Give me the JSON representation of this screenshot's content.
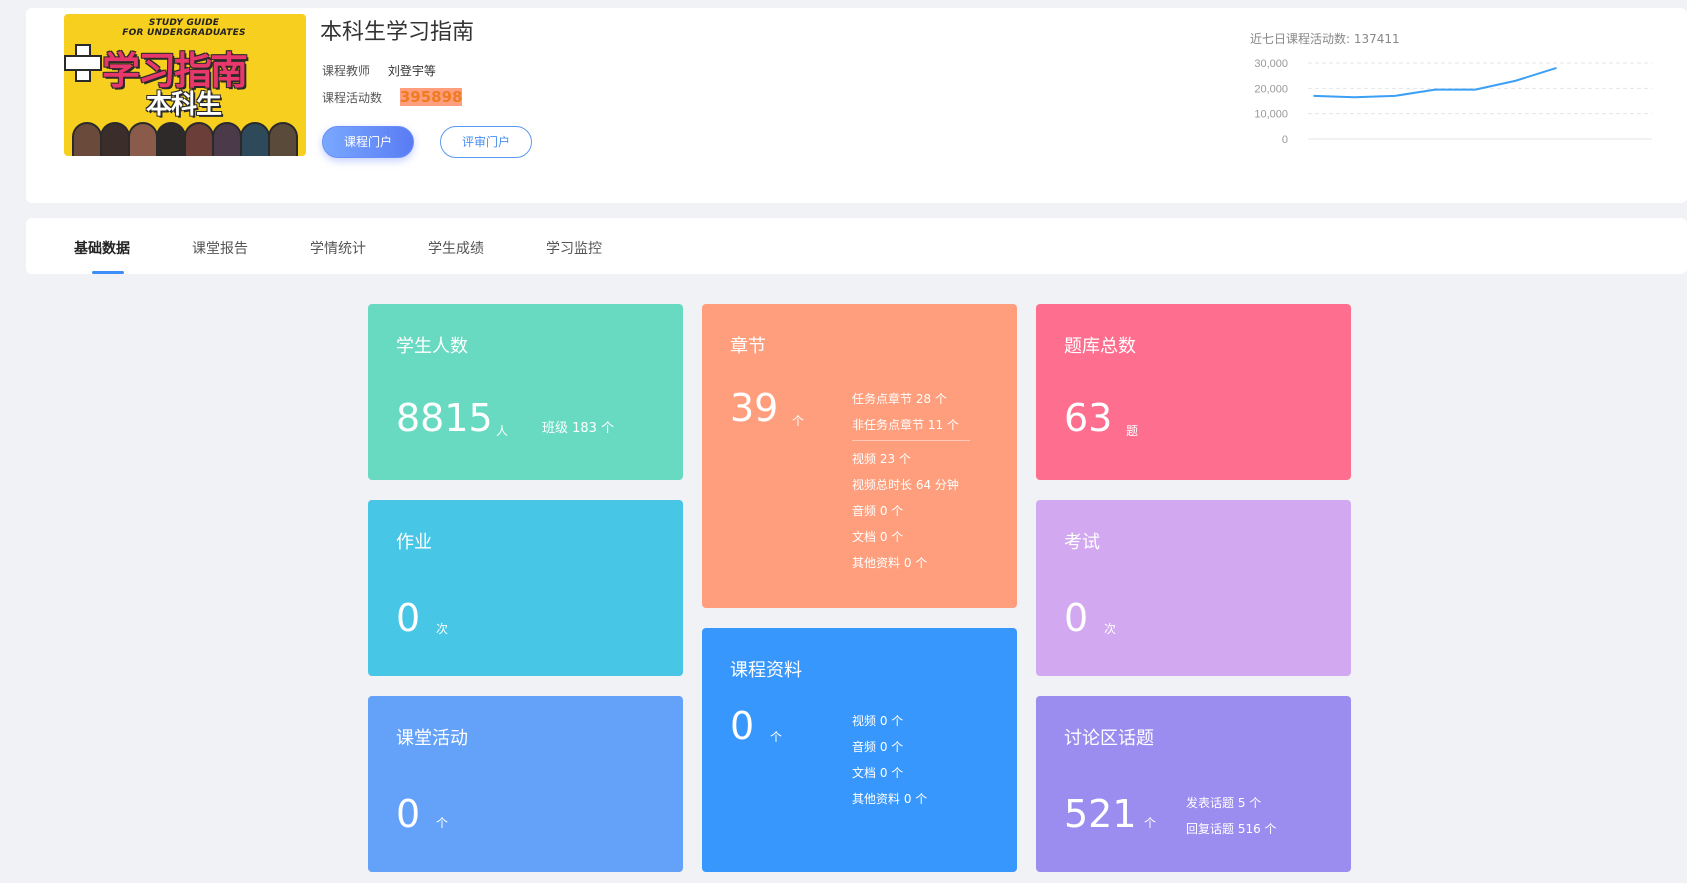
{
  "course": {
    "cover_en_line1": "STUDY GUIDE",
    "cover_en_line2": "FOR UNDERGRADUATES",
    "cover_title": "学习指南",
    "cover_subtitle": "本科生",
    "title": "本科生学习指南",
    "teacher_label": "课程教师",
    "teacher_value": "刘登宇等",
    "activity_label": "课程活动数",
    "activity_value": "395898",
    "btn_portal": "课程门户",
    "btn_review": "评审门户"
  },
  "trend": {
    "label": "近七日课程活动数: 137411",
    "y_ticks": [
      "30,000",
      "20,000",
      "10,000",
      "0"
    ]
  },
  "chart_data": {
    "type": "line",
    "title": "近七日课程活动数: 137411",
    "ylim": [
      0,
      30000
    ],
    "y_ticks": [
      "30,000",
      "20,000",
      "10,000",
      "0"
    ],
    "x": [
      1,
      2,
      3,
      4,
      5,
      6,
      7
    ],
    "series": [
      {
        "values": [
          17000,
          16500,
          17000,
          19500,
          19500,
          23000,
          28000
        ]
      }
    ],
    "grid": true,
    "color": "#3a9ff5"
  },
  "tabs": [
    {
      "label": "基础数据",
      "active": true
    },
    {
      "label": "课堂报告",
      "active": false
    },
    {
      "label": "学情统计",
      "active": false
    },
    {
      "label": "学生成绩",
      "active": false
    },
    {
      "label": "学习监控",
      "active": false
    }
  ],
  "cards": {
    "students": {
      "title": "学生人数",
      "value": "8815",
      "unit": "人",
      "side": "班级 183 个",
      "color": "#67dac1"
    },
    "homework": {
      "title": "作业",
      "value": "0",
      "unit": "次",
      "color": "#47c6e6"
    },
    "activity": {
      "title": "课堂活动",
      "value": "0",
      "unit": "个",
      "color": "#64a1f9"
    },
    "chapters": {
      "title": "章节",
      "value": "39",
      "unit": "个",
      "side_top": [
        "任务点章节 28 个",
        "非任务点章节 11 个"
      ],
      "side_bottom": [
        "视频 23 个",
        "视频总时长 64 分钟",
        "音频 0 个",
        "文档 0 个",
        "其他资料 0 个"
      ],
      "color": "#fe9e7c"
    },
    "materials": {
      "title": "课程资料",
      "value": "0",
      "unit": "个",
      "side": [
        "视频 0 个",
        "音频 0 个",
        "文档 0 个",
        "其他资料 0 个"
      ],
      "color": "#3897fd"
    },
    "questions": {
      "title": "题库总数",
      "value": "63",
      "unit": "题",
      "color": "#fe6f8f"
    },
    "exams": {
      "title": "考试",
      "value": "0",
      "unit": "次",
      "color": "#d2a8f0"
    },
    "forum": {
      "title": "讨论区话题",
      "value": "521",
      "unit": "个",
      "side": [
        "发表话题 5 个",
        "回复话题 516 个"
      ],
      "color": "#9b8cef"
    }
  }
}
